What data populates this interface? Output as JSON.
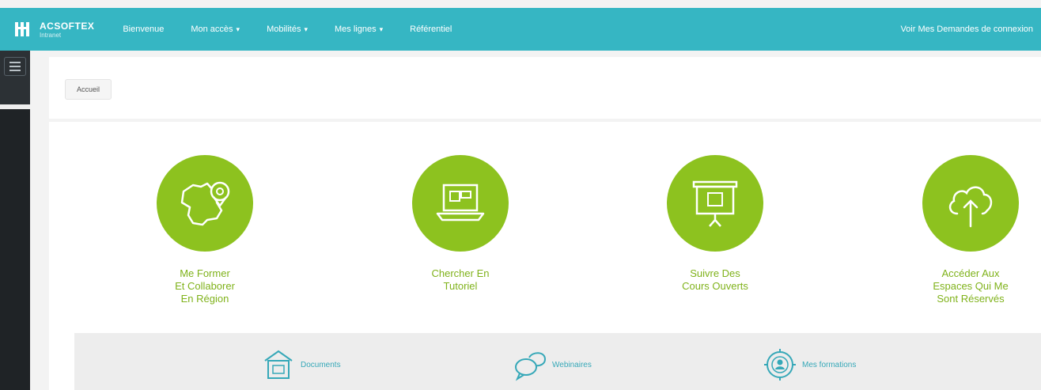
{
  "brand": {
    "name": "ACSOFTEX",
    "tagline": "Intranet"
  },
  "nav": {
    "items": [
      {
        "label": "Bienvenue",
        "caret": false
      },
      {
        "label": "Mon accès",
        "caret": true
      },
      {
        "label": "Mobilités",
        "caret": true
      },
      {
        "label": "Mes lignes",
        "caret": true
      },
      {
        "label": "Référentiel",
        "caret": false
      }
    ],
    "user_link": "Voir Mes Demandes de connexion"
  },
  "breadcrumb": {
    "label": "Accueil"
  },
  "cards": [
    {
      "label": "Me Former\nEt Collaborer\nEn Région",
      "icon": "france-map-pin-icon"
    },
    {
      "label": "Chercher En\nTutoriel",
      "icon": "laptop-screen-icon"
    },
    {
      "label": "Suivre Des\nCours Ouverts",
      "icon": "presentation-board-icon"
    },
    {
      "label": "Accéder Aux\nEspaces Qui Me\nSont Réservés",
      "icon": "cloud-upload-icon"
    }
  ],
  "strip": [
    {
      "label": "Documents",
      "icon": "calendar-house-icon"
    },
    {
      "label": "Webinaires",
      "icon": "chat-bubbles-icon"
    },
    {
      "label": "Mes formations",
      "icon": "target-person-icon"
    }
  ],
  "colors": {
    "topbar": "#36b6c3",
    "accent_green": "#8dc21f",
    "label_green": "#7fb21a",
    "strip_teal": "#36a8b8",
    "rail": "#1f2326"
  }
}
